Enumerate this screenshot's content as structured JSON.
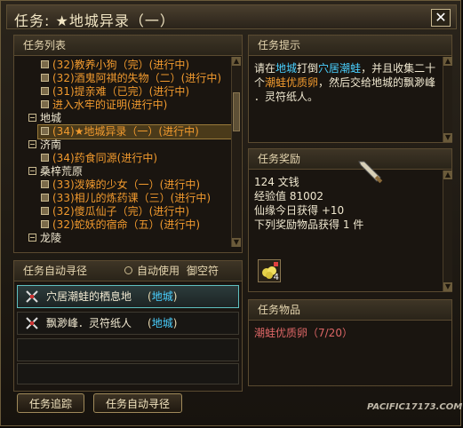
{
  "window": {
    "title": "任务: ★地城异录（一）",
    "close_label": "✕"
  },
  "task_list": {
    "header": "任务列表",
    "rows": [
      {
        "text": "(32)教养小狗（完）(进行中)"
      },
      {
        "text": "(32)酒鬼阿祺的失物（二）(进行中)"
      },
      {
        "text": "(31)提亲难（已完）(进行中)"
      },
      {
        "text": "进入水牢的证明(进行中)"
      },
      {
        "text": "地城"
      },
      {
        "text": "(34)★地城异录（一）(进行中)"
      },
      {
        "text": "济南"
      },
      {
        "text": "(34)药食同源(进行中)"
      },
      {
        "text": "桑梓荒原"
      },
      {
        "text": "(33)泼辣的少女（一）(进行中)"
      },
      {
        "text": "(33)相儿的炼药课（三）(进行中)"
      },
      {
        "text": "(32)傻瓜仙子（完）(进行中)"
      },
      {
        "text": "(32)蛇妖的宿命（五）(进行中)"
      },
      {
        "text": "龙陵"
      }
    ]
  },
  "auto_path": {
    "header": "任务自动寻径",
    "checkbox_label": "自动使用",
    "item_label": "御空符",
    "rows": [
      {
        "place": "穴居潮蛙的栖息地",
        "zone": "地城"
      },
      {
        "place": "飘渺峰．灵符纸人",
        "zone": "地城"
      }
    ]
  },
  "hint": {
    "header": "任务提示",
    "lines": [
      {
        "parts": [
          {
            "t": "请在",
            "c": "white"
          },
          {
            "t": "地城",
            "c": "cyan"
          },
          {
            "t": "打倒",
            "c": "white"
          },
          {
            "t": "穴居潮蛙",
            "c": "cyan"
          },
          {
            "t": "，并且收集二十",
            "c": "white"
          }
        ]
      },
      {
        "parts": [
          {
            "t": "个",
            "c": "white"
          },
          {
            "t": "潮蛙优质卵",
            "c": "orange"
          },
          {
            "t": "，然后交给地城的飘渺峰",
            "c": "white"
          }
        ]
      },
      {
        "parts": [
          {
            "t": "．灵符纸人。",
            "c": "white"
          }
        ]
      }
    ]
  },
  "reward": {
    "header": "任务奖励",
    "lines": [
      "124 文钱",
      "经验值 81002",
      "仙缘今日获得 +10",
      "下列奖励物品获得 1 件"
    ],
    "item_count": "4"
  },
  "goods": {
    "header": "任务物品",
    "line": "潮蛙优质卵（7/20）"
  },
  "buttons": {
    "track": "任务追踪",
    "auto": "任务自动寻径"
  },
  "watermark": {
    "text": "PACIFIC17173.COM"
  }
}
